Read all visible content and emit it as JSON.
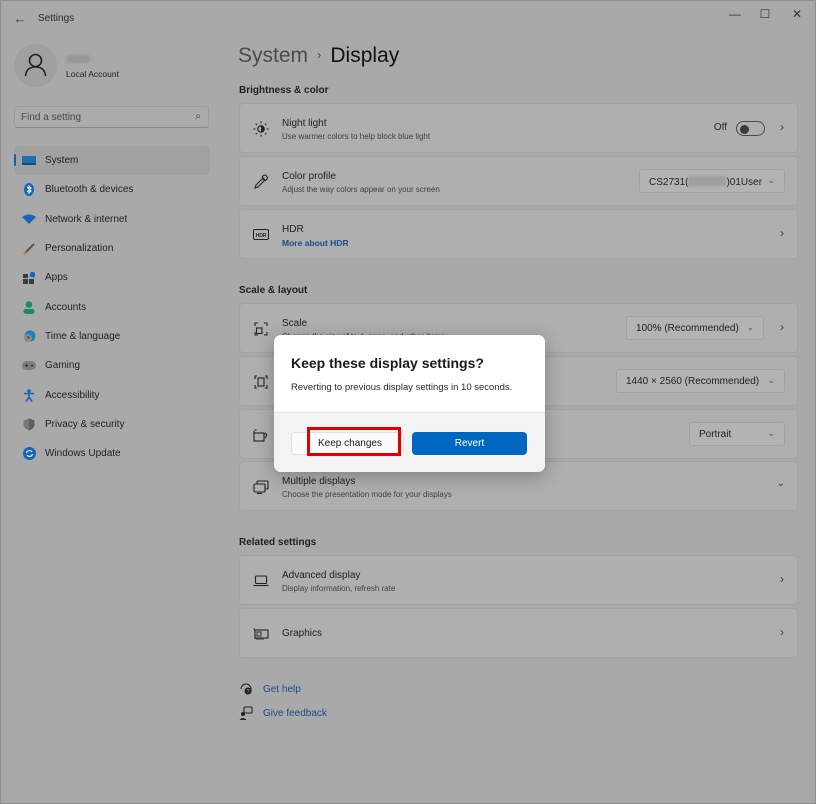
{
  "window": {
    "app_title": "Settings",
    "controls": {
      "minimize": "—",
      "maximize": "☐",
      "close": "✕"
    }
  },
  "account": {
    "name_redacted": true,
    "type": "Local Account"
  },
  "search": {
    "placeholder": "Find a setting",
    "value": ""
  },
  "sidebar": {
    "items": [
      {
        "label": "System",
        "icon": "system-icon",
        "active": true
      },
      {
        "label": "Bluetooth & devices",
        "icon": "bluetooth-icon"
      },
      {
        "label": "Network & internet",
        "icon": "wifi-icon"
      },
      {
        "label": "Personalization",
        "icon": "brush-icon"
      },
      {
        "label": "Apps",
        "icon": "apps-icon"
      },
      {
        "label": "Accounts",
        "icon": "person-icon"
      },
      {
        "label": "Time & language",
        "icon": "clock-globe-icon"
      },
      {
        "label": "Gaming",
        "icon": "gamepad-icon"
      },
      {
        "label": "Accessibility",
        "icon": "accessibility-icon"
      },
      {
        "label": "Privacy & security",
        "icon": "shield-icon"
      },
      {
        "label": "Windows Update",
        "icon": "update-icon"
      }
    ]
  },
  "breadcrumb": {
    "parent": "System",
    "separator": "›",
    "current": "Display"
  },
  "sections": {
    "brightness": {
      "title": "Brightness & color",
      "night_light": {
        "title": "Night light",
        "subtitle": "Use warmer colors to help block blue light",
        "toggle_label": "Off",
        "toggle_on": false
      },
      "color_profile": {
        "title": "Color profile",
        "subtitle": "Adjust the way colors appear on your screen",
        "value_prefix": "CS2731(",
        "value_suffix": ")01User"
      },
      "hdr": {
        "title": "HDR",
        "link": "More about HDR"
      }
    },
    "scale_layout": {
      "title": "Scale & layout",
      "scale": {
        "title": "Scale",
        "subtitle": "Change the size of text, apps, and other items",
        "value": "100% (Recommended)"
      },
      "resolution": {
        "value": "1440 × 2560 (Recommended)"
      },
      "orientation": {
        "value": "Portrait"
      },
      "multiple_displays": {
        "title": "Multiple displays",
        "subtitle": "Choose the presentation mode for your displays"
      }
    },
    "related": {
      "title": "Related settings",
      "advanced_display": {
        "title": "Advanced display",
        "subtitle": "Display information, refresh rate"
      },
      "graphics": {
        "title": "Graphics"
      }
    }
  },
  "help": {
    "get_help": "Get help",
    "give_feedback": "Give feedback"
  },
  "dialog": {
    "title": "Keep these display settings?",
    "message": "Reverting to previous display settings in 10 seconds.",
    "keep_label": "Keep changes",
    "revert_label": "Revert",
    "countdown_seconds": 10
  },
  "colors": {
    "accent": "#0067c0",
    "link": "#1b4c8a",
    "highlight": "#e10000"
  }
}
